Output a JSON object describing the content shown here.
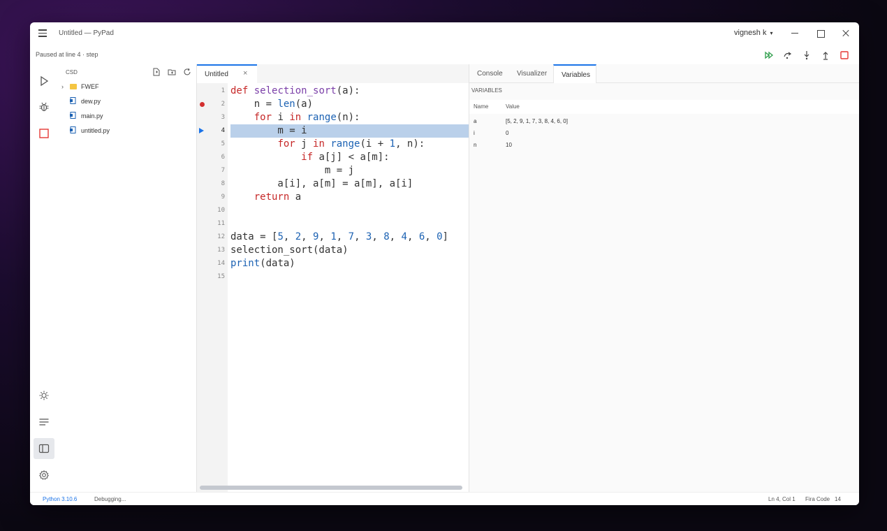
{
  "window": {
    "title": "Untitled — PyPad",
    "user": "vignesh k"
  },
  "status": {
    "paused": "Paused at line 4  ·  step"
  },
  "debug_toolbar": {
    "icons": [
      "continue-icon",
      "step-over-icon",
      "step-into-icon",
      "step-out-icon",
      "stop-icon"
    ],
    "colors": {
      "continue": "#2e9e4b",
      "stop": "#e53935"
    }
  },
  "activity": [
    "run-icon",
    "debug-icon",
    "stop-icon",
    "theme-icon",
    "outline-icon",
    "sidebar-icon",
    "settings-icon"
  ],
  "explorer": {
    "title": "CSD",
    "items": [
      {
        "label": "FWEF",
        "type": "folder"
      },
      {
        "label": "dew.py",
        "type": "file"
      },
      {
        "label": "main.py",
        "type": "file"
      },
      {
        "label": "untitled.py",
        "type": "file"
      }
    ]
  },
  "editor": {
    "tab": "Untitled",
    "current_line": 4,
    "breakpoint_line": 2,
    "line_numbers": [
      "1",
      "2",
      "3",
      "4",
      "5",
      "6",
      "7",
      "8",
      "9",
      "10",
      "11",
      "12",
      "13",
      "14",
      "15"
    ]
  },
  "code_lines": [
    "def selection_sort(a):",
    "    n = len(a)",
    "    for i in range(n):",
    "        m = i",
    "        for j in range(i + 1, n):",
    "            if a[j] < a[m]:",
    "                m = j",
    "        a[i], a[m] = a[m], a[i]",
    "    return a",
    "",
    "",
    "data = [5, 2, 9, 1, 7, 3, 8, 4, 6, 0]",
    "selection_sort(data)",
    "print(data)",
    ""
  ],
  "right_panel": {
    "tabs": [
      "Console",
      "Visualizer",
      "Variables"
    ],
    "active_tab": "Variables",
    "section": "VARIABLES",
    "headers": {
      "name": "Name",
      "value": "Value"
    },
    "variables": [
      {
        "name": "a",
        "value": "[5, 2, 9, 1, 7, 3, 8, 4, 6, 0]"
      },
      {
        "name": "i",
        "value": "0"
      },
      {
        "name": "n",
        "value": "10"
      }
    ]
  },
  "statusbar": {
    "python": "Python 3.10.6",
    "state": "Debugging...",
    "position": "Ln 4, Col 1",
    "font": "Fira Code",
    "font_size": "14"
  }
}
